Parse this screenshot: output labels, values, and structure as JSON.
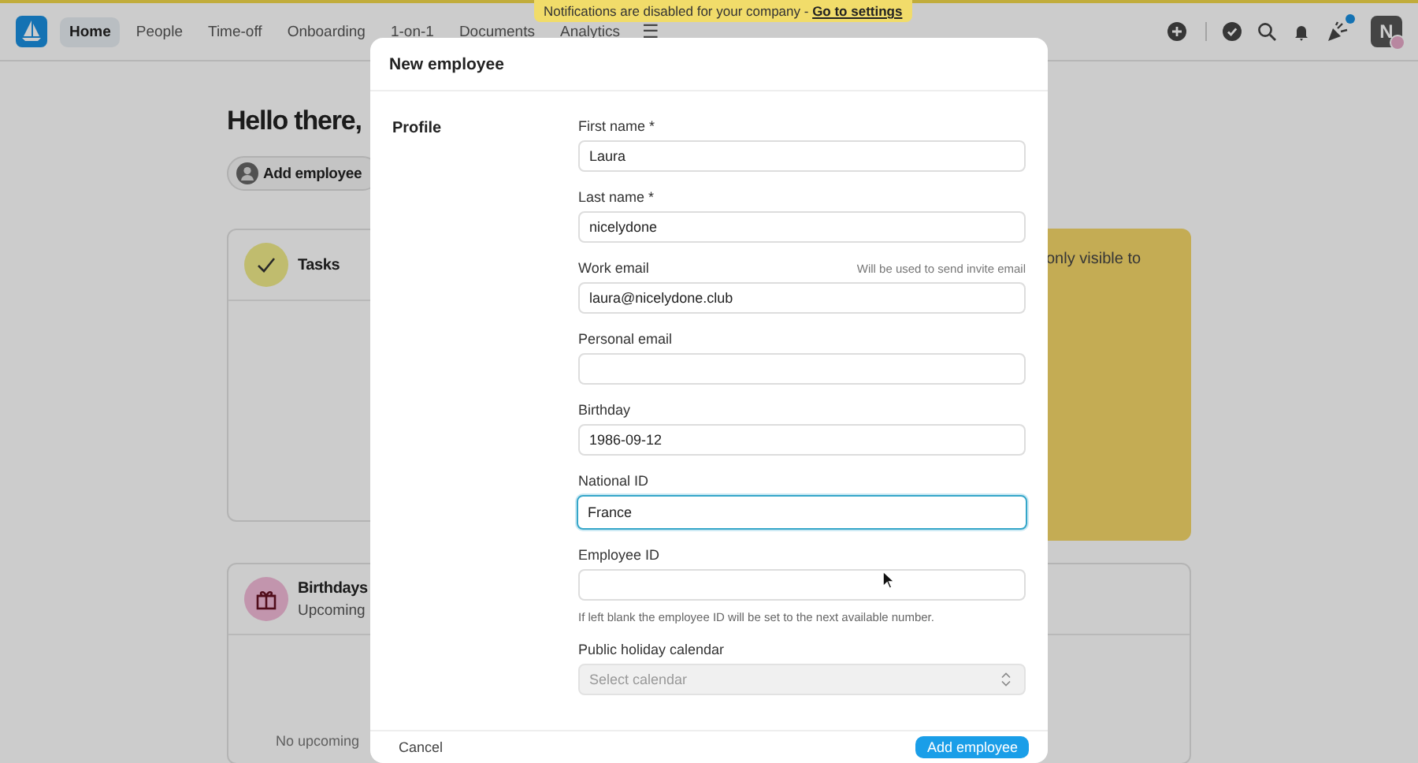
{
  "banner": {
    "text": "Notifications are disabled for your company - ",
    "link": "Go to settings"
  },
  "nav": {
    "tabs": [
      {
        "label": "Home",
        "selected": true
      },
      {
        "label": "People",
        "selected": false
      },
      {
        "label": "Time-off",
        "selected": false
      },
      {
        "label": "Onboarding",
        "selected": false
      },
      {
        "label": "1-on-1",
        "selected": false
      },
      {
        "label": "Documents",
        "selected": false
      },
      {
        "label": "Analytics",
        "selected": false
      }
    ],
    "menu": "☰",
    "avatar": "N"
  },
  "home": {
    "greeting": "Hello there,",
    "add_button": "Add employee",
    "tasks": {
      "title": "Tasks"
    },
    "notice": {
      "text": "only visible to"
    },
    "birthdays": {
      "title": "Birthdays",
      "subtitle": "Upcoming",
      "empty": "No upcoming"
    }
  },
  "modal": {
    "title": "New employee",
    "section": "Profile",
    "fields": [
      {
        "kind": "text",
        "label": "First name *",
        "value": "Laura",
        "focused": false
      },
      {
        "kind": "text",
        "label": "Last name *",
        "value": "nicelydone",
        "focused": false
      },
      {
        "kind": "text",
        "label": "Work email",
        "note": "Will be used to send invite email",
        "value": "laura@nicelydone.club",
        "focused": false
      },
      {
        "kind": "text",
        "label": "Personal email",
        "focused": false
      },
      {
        "kind": "text",
        "label": "Birthday",
        "value": "1986-09-12",
        "focused": false
      },
      {
        "kind": "text",
        "label": "National ID",
        "value": "France",
        "focused": true
      },
      {
        "kind": "text",
        "label": "Employee ID",
        "help": "If left blank the employee ID will be set to the next available number.",
        "focused": false
      },
      {
        "kind": "select",
        "label": "Public holiday calendar",
        "placeholder": "Select calendar",
        "disabled": true,
        "focused": false
      }
    ],
    "cancel": "Cancel",
    "submit": "Add employee"
  }
}
